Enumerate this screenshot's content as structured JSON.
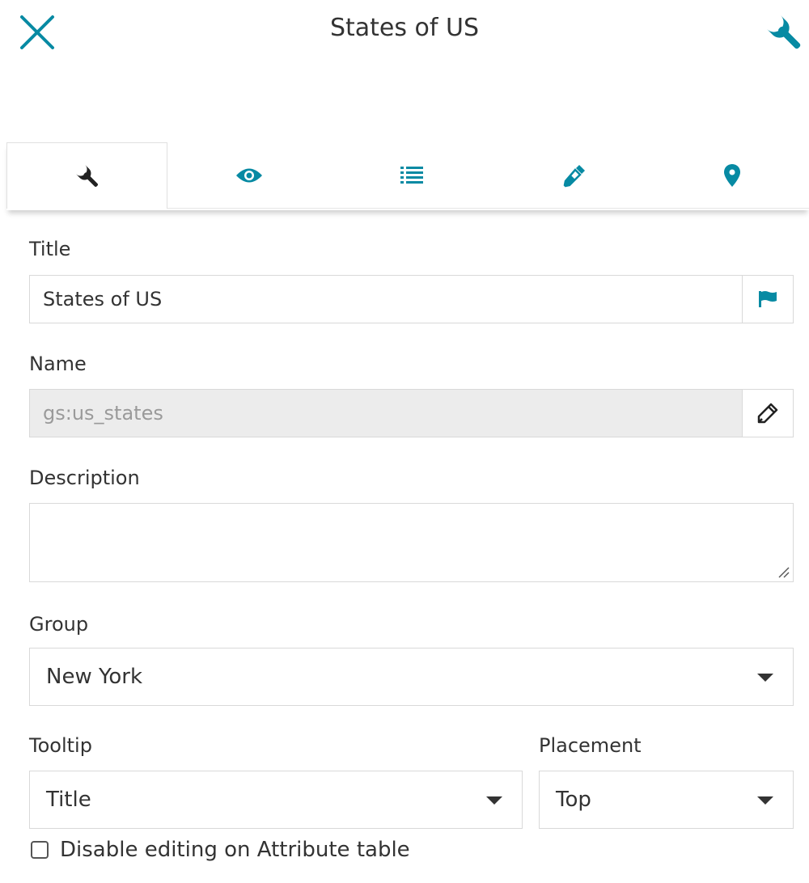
{
  "header": {
    "title": "States of US",
    "close_icon": "close-icon",
    "settings_icon": "wrench-icon"
  },
  "tabs": [
    {
      "icon": "wrench-icon",
      "active": true
    },
    {
      "icon": "eye-icon",
      "active": false
    },
    {
      "icon": "list-icon",
      "active": false
    },
    {
      "icon": "eyedropper-icon",
      "active": false
    },
    {
      "icon": "map-marker-icon",
      "active": false
    }
  ],
  "form": {
    "title_label": "Title",
    "title_value": "States of US",
    "name_label": "Name",
    "name_value": "gs:us_states",
    "description_label": "Description",
    "description_value": "",
    "group_label": "Group",
    "group_value": "New York",
    "tooltip_label": "Tooltip",
    "tooltip_value": "Title",
    "placement_label": "Placement",
    "placement_value": "Top",
    "disable_editing_label": "Disable editing on Attribute table",
    "disable_editing_checked": false
  },
  "colors": {
    "accent": "#078aa3",
    "text": "#333333",
    "border": "#d9d9d9",
    "disabled_bg": "#ececec"
  }
}
